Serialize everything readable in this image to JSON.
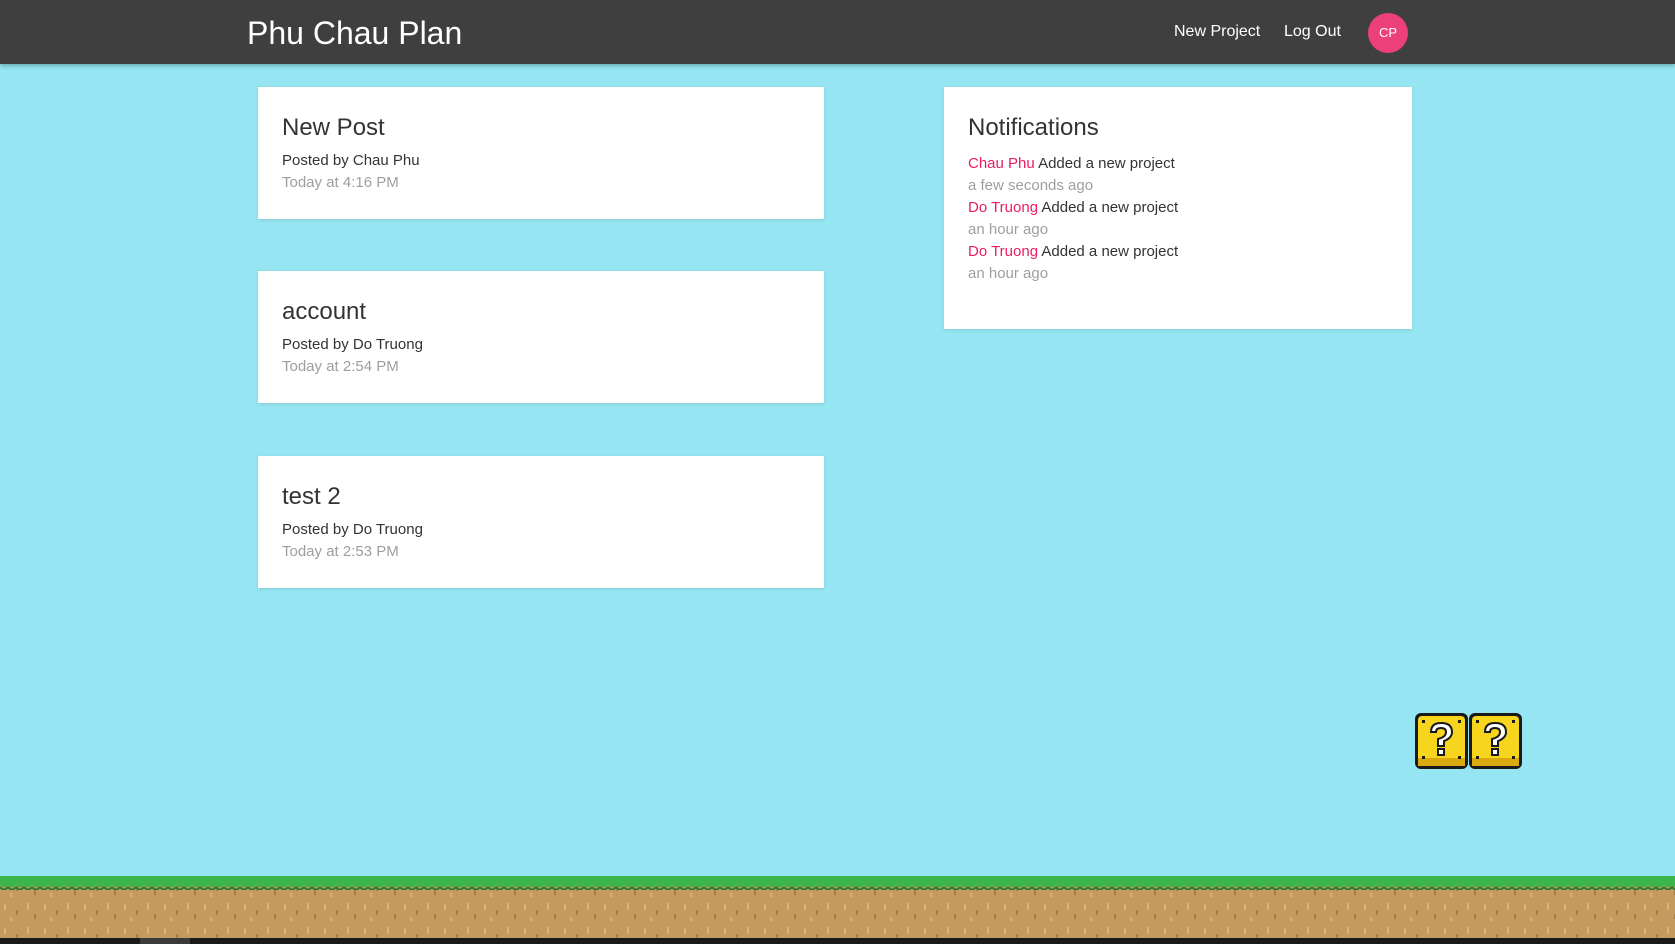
{
  "navbar": {
    "brand": "Phu Chau Plan",
    "new_project_label": "New Project",
    "logout_label": "Log Out",
    "avatar_initials": "CP",
    "avatar_color": "#ec407a"
  },
  "posts": [
    {
      "title": "New Post",
      "author_line": "Posted by Chau Phu",
      "time": "Today at 4:16 PM"
    },
    {
      "title": "account",
      "author_line": "Posted by Do Truong",
      "time": "Today at 2:54 PM"
    },
    {
      "title": "test 2",
      "author_line": "Posted by Do Truong",
      "time": "Today at 2:53 PM"
    }
  ],
  "notifications": {
    "title": "Notifications",
    "items": [
      {
        "user": "Chau Phu",
        "action": "Added a new project",
        "time": "a few seconds ago"
      },
      {
        "user": "Do Truong",
        "action": "Added a new project",
        "time": "an hour ago"
      },
      {
        "user": "Do Truong",
        "action": "Added a new project",
        "time": "an hour ago"
      }
    ]
  },
  "colors": {
    "background_sky": "#95e6f2",
    "navbar": "#3f3f3f",
    "accent_pink": "#e91e63",
    "grass": "#3cb54a",
    "dirt": "#c49a5f"
  },
  "decorations": {
    "question_blocks_icon": "question-block-icon",
    "ground_icon": "grass-ground"
  }
}
